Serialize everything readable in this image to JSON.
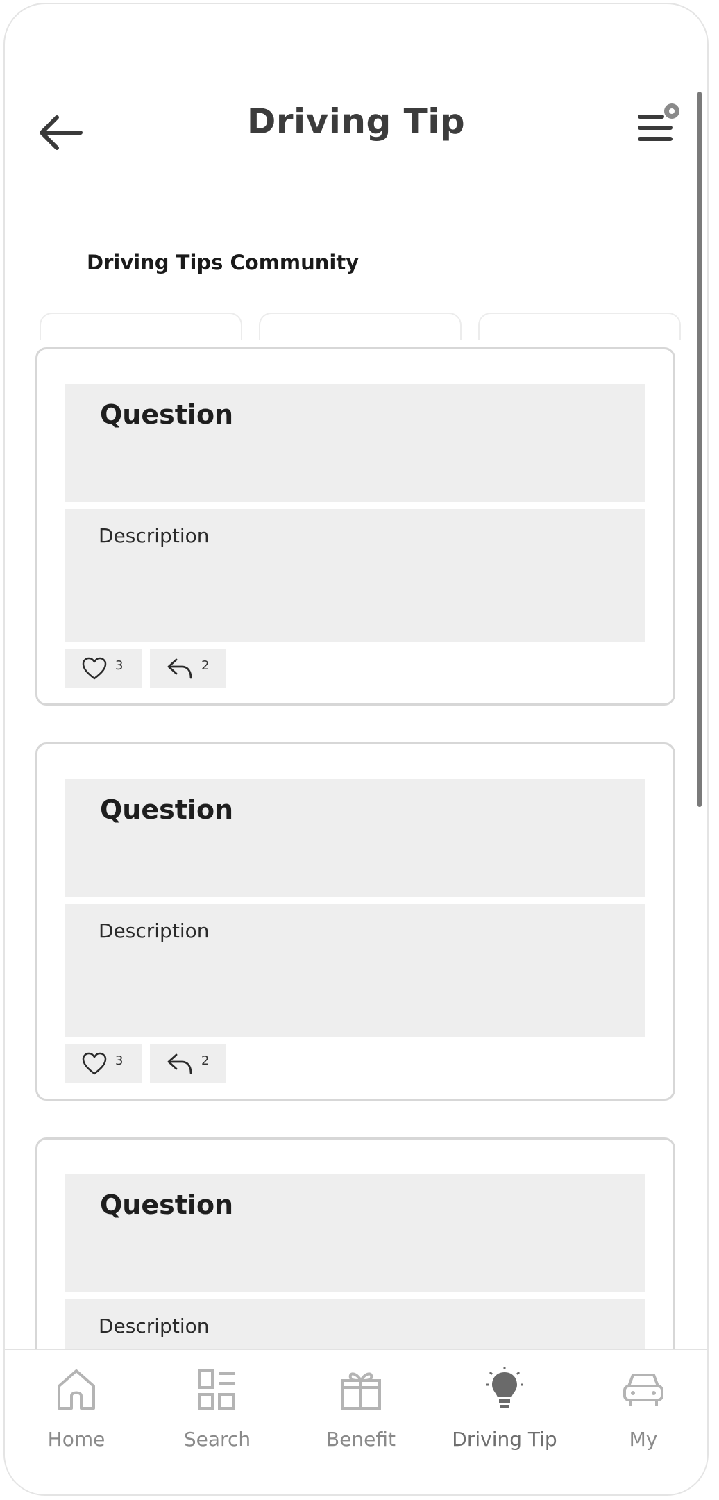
{
  "header": {
    "title": "Driving Tip",
    "back_icon": "arrow-left-icon",
    "menu_icon": "menu-notification-icon"
  },
  "community": {
    "title": "Driving Tips Community"
  },
  "posts": [
    {
      "question": "Question",
      "description": "Description",
      "likes": "3",
      "replies": "2"
    },
    {
      "question": "Question",
      "description": "Description",
      "likes": "3",
      "replies": "2"
    },
    {
      "question": "Question",
      "description": "Description"
    }
  ],
  "nav": {
    "items": [
      {
        "label": "Home",
        "icon": "home-icon"
      },
      {
        "label": "Search",
        "icon": "grid-search-icon"
      },
      {
        "label": "Benefit",
        "icon": "gift-icon"
      },
      {
        "label": "Driving Tip",
        "icon": "lightbulb-icon",
        "active": true
      },
      {
        "label": "My",
        "icon": "car-icon"
      }
    ]
  },
  "colors": {
    "card_fill": "#eeeeee",
    "card_border": "#d7d7d7",
    "nav_label": "#8a8a8a"
  }
}
